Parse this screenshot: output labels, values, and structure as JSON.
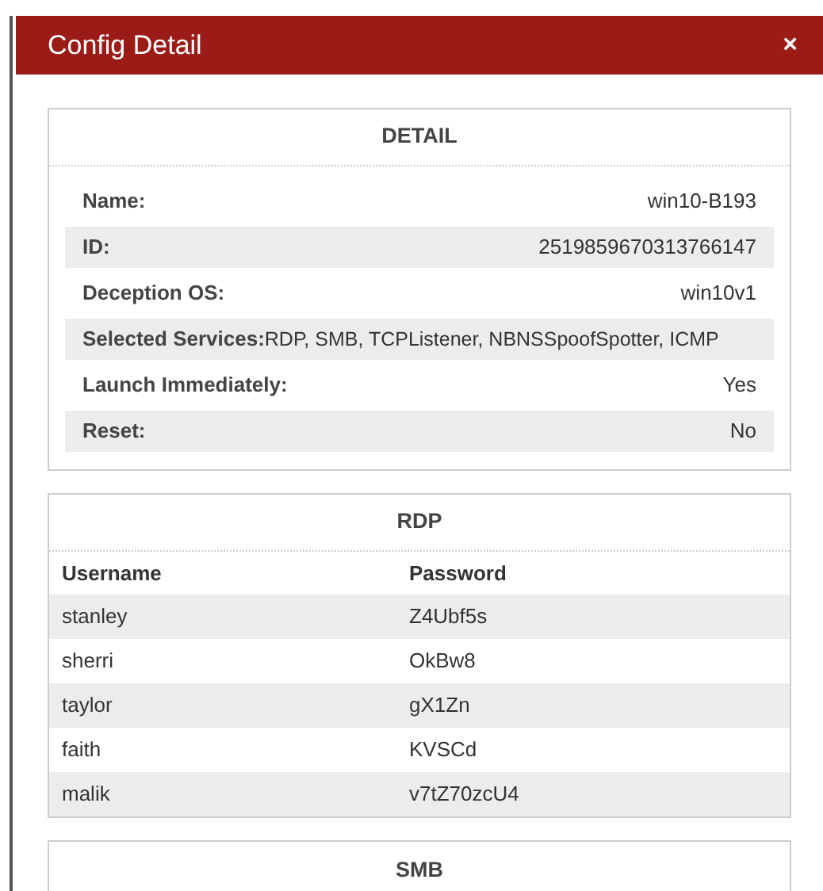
{
  "dialog": {
    "title": "Config Detail",
    "close": "×"
  },
  "detail": {
    "title": "DETAIL",
    "rows": [
      {
        "kind": "pair",
        "label": "Name:",
        "value": "win10-B193"
      },
      {
        "kind": "pair",
        "label": "ID:",
        "value": "2519859670313766147"
      },
      {
        "kind": "pair",
        "label": "Deception OS:",
        "value": "win10v1"
      },
      {
        "kind": "inline",
        "label": "Selected Services:",
        "value": "RDP, SMB, TCPListener, NBNSSpoofSpotter, ICMP"
      },
      {
        "kind": "pair",
        "label": "Launch Immediately:",
        "value": "Yes"
      },
      {
        "kind": "pair",
        "label": "Reset:",
        "value": "No"
      }
    ]
  },
  "services": [
    {
      "title": "RDP",
      "columns": [
        "Username",
        "Password"
      ],
      "rows": [
        [
          "stanley",
          "Z4Ubf5s"
        ],
        [
          "sherri",
          "OkBw8"
        ],
        [
          "taylor",
          "gX1Zn"
        ],
        [
          "faith",
          "KVSCd"
        ],
        [
          "malik",
          "v7tZ70zcU4"
        ]
      ]
    },
    {
      "title": "SMB"
    }
  ]
}
